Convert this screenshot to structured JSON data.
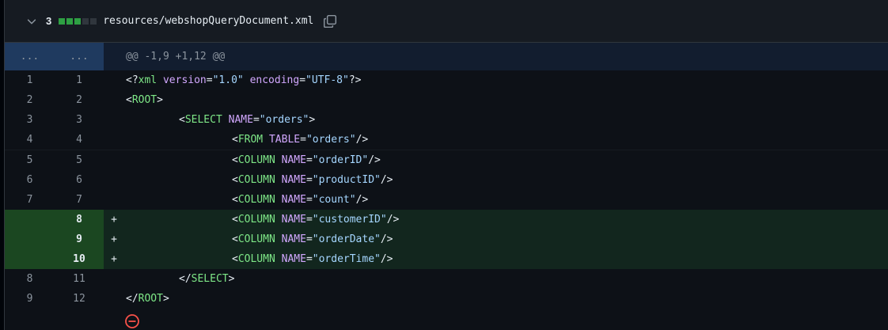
{
  "file": {
    "change_count": "3",
    "path": "resources/webshopQueryDocument.xml",
    "diffstat": [
      "added",
      "added",
      "added",
      "neutral",
      "neutral"
    ]
  },
  "hunk": {
    "old_ellipsis": "...",
    "new_ellipsis": "...",
    "header": "@@ -1,9 +1,12 @@"
  },
  "lines": [
    {
      "old": "1",
      "new": "1",
      "marker": "",
      "type": "ctx",
      "indent": "",
      "tokens": [
        [
          "p",
          "<?"
        ],
        [
          "t",
          "xml"
        ],
        [
          "x",
          " "
        ],
        [
          "a",
          "version"
        ],
        [
          "p",
          "="
        ],
        [
          "s",
          "\"1.0\""
        ],
        [
          "x",
          " "
        ],
        [
          "a",
          "encoding"
        ],
        [
          "p",
          "="
        ],
        [
          "s",
          "\"UTF-8\""
        ],
        [
          "p",
          "?>"
        ]
      ]
    },
    {
      "old": "2",
      "new": "2",
      "marker": "",
      "type": "ctx",
      "indent": "",
      "tokens": [
        [
          "p",
          "<"
        ],
        [
          "t",
          "ROOT"
        ],
        [
          "p",
          ">"
        ]
      ]
    },
    {
      "old": "3",
      "new": "3",
      "marker": "",
      "type": "ctx",
      "indent": "\t",
      "tokens": [
        [
          "p",
          "<"
        ],
        [
          "t",
          "SELECT"
        ],
        [
          "x",
          " "
        ],
        [
          "a",
          "NAME"
        ],
        [
          "p",
          "="
        ],
        [
          "s",
          "\"orders\""
        ],
        [
          "p",
          ">"
        ]
      ]
    },
    {
      "old": "4",
      "new": "4",
      "marker": "",
      "type": "ctx",
      "indent": "\t\t",
      "tokens": [
        [
          "p",
          "<"
        ],
        [
          "t",
          "FROM"
        ],
        [
          "x",
          " "
        ],
        [
          "a",
          "TABLE"
        ],
        [
          "p",
          "="
        ],
        [
          "s",
          "\"orders\""
        ],
        [
          "p",
          "/>"
        ]
      ]
    },
    {
      "old": "5",
      "new": "5",
      "marker": "",
      "type": "ctx",
      "indent": "\t\t",
      "tokens": [
        [
          "p",
          "<"
        ],
        [
          "t",
          "COLUMN"
        ],
        [
          "x",
          " "
        ],
        [
          "a",
          "NAME"
        ],
        [
          "p",
          "="
        ],
        [
          "s",
          "\"orderID\""
        ],
        [
          "p",
          "/>"
        ]
      ]
    },
    {
      "old": "6",
      "new": "6",
      "marker": "",
      "type": "ctx",
      "indent": "\t\t",
      "tokens": [
        [
          "p",
          "<"
        ],
        [
          "t",
          "COLUMN"
        ],
        [
          "x",
          " "
        ],
        [
          "a",
          "NAME"
        ],
        [
          "p",
          "="
        ],
        [
          "s",
          "\"productID\""
        ],
        [
          "p",
          "/>"
        ]
      ]
    },
    {
      "old": "7",
      "new": "7",
      "marker": "",
      "type": "ctx",
      "indent": "\t\t",
      "tokens": [
        [
          "p",
          "<"
        ],
        [
          "t",
          "COLUMN"
        ],
        [
          "x",
          " "
        ],
        [
          "a",
          "NAME"
        ],
        [
          "p",
          "="
        ],
        [
          "s",
          "\"count\""
        ],
        [
          "p",
          "/>"
        ]
      ]
    },
    {
      "old": "",
      "new": "8",
      "marker": "+",
      "type": "add",
      "indent": "\t\t",
      "tokens": [
        [
          "p",
          "<"
        ],
        [
          "t",
          "COLUMN"
        ],
        [
          "x",
          " "
        ],
        [
          "a",
          "NAME"
        ],
        [
          "p",
          "="
        ],
        [
          "s",
          "\"customerID\""
        ],
        [
          "p",
          "/>"
        ]
      ]
    },
    {
      "old": "",
      "new": "9",
      "marker": "+",
      "type": "add",
      "indent": "\t\t",
      "tokens": [
        [
          "p",
          "<"
        ],
        [
          "t",
          "COLUMN"
        ],
        [
          "x",
          " "
        ],
        [
          "a",
          "NAME"
        ],
        [
          "p",
          "="
        ],
        [
          "s",
          "\"orderDate\""
        ],
        [
          "p",
          "/>"
        ]
      ]
    },
    {
      "old": "",
      "new": "10",
      "marker": "+",
      "type": "add",
      "indent": "\t\t",
      "tokens": [
        [
          "p",
          "<"
        ],
        [
          "t",
          "COLUMN"
        ],
        [
          "x",
          " "
        ],
        [
          "a",
          "NAME"
        ],
        [
          "p",
          "="
        ],
        [
          "s",
          "\"orderTime\""
        ],
        [
          "p",
          "/>"
        ]
      ]
    },
    {
      "old": "8",
      "new": "11",
      "marker": "",
      "type": "ctx",
      "indent": "\t",
      "tokens": [
        [
          "p",
          "</"
        ],
        [
          "t",
          "SELECT"
        ],
        [
          "p",
          ">"
        ]
      ]
    },
    {
      "old": "9",
      "new": "12",
      "marker": "",
      "type": "ctx",
      "indent": "",
      "tokens": [
        [
          "p",
          "</"
        ],
        [
          "t",
          "ROOT"
        ],
        [
          "p",
          ">"
        ]
      ]
    }
  ],
  "icons": {
    "collapse": "chevron-down-icon",
    "copy": "copy-icon",
    "no_newline": "no-entry-icon"
  },
  "colors": {
    "added": "#2ea043",
    "tag": "#7ee787",
    "attr": "#d2a8ff",
    "string": "#a5d6ff",
    "removed_icon": "#f85149"
  }
}
